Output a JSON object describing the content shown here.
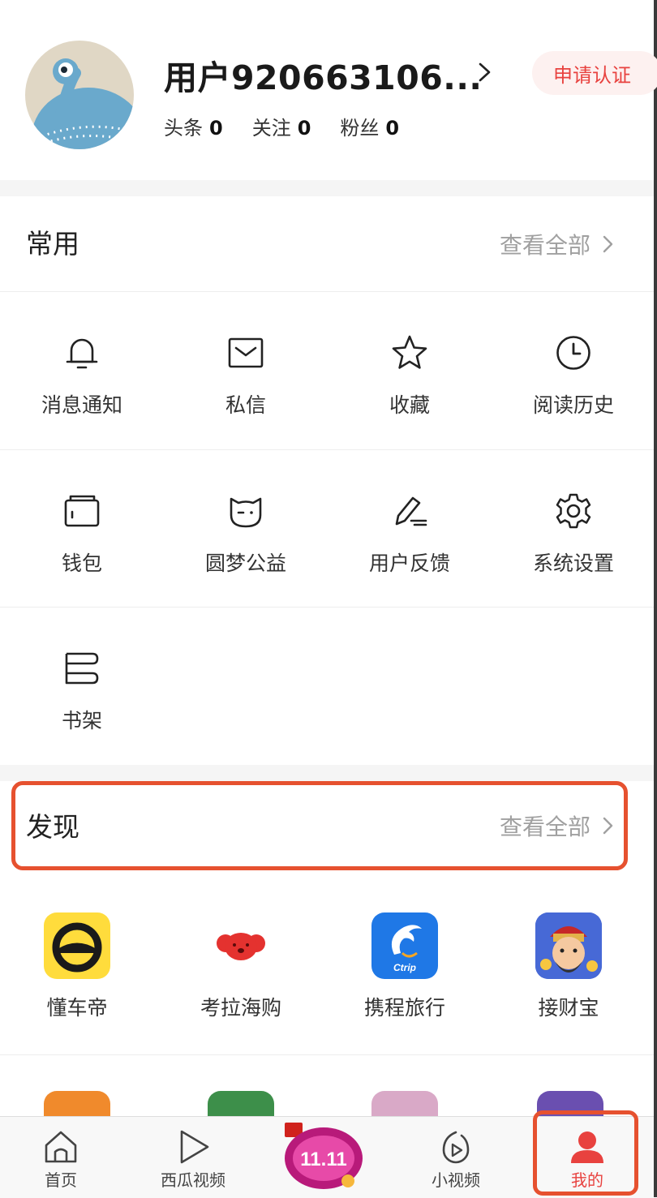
{
  "profile": {
    "username": "用户920663106...",
    "verify_label": "申请认证",
    "stats": [
      {
        "label": "头条",
        "value": "0"
      },
      {
        "label": "关注",
        "value": "0"
      },
      {
        "label": "粉丝",
        "value": "0"
      }
    ]
  },
  "common": {
    "title": "常用",
    "more": "查看全部",
    "items": [
      {
        "label": "消息通知",
        "icon": "bell-icon"
      },
      {
        "label": "私信",
        "icon": "mail-icon"
      },
      {
        "label": "收藏",
        "icon": "star-icon"
      },
      {
        "label": "阅读历史",
        "icon": "clock-icon"
      },
      {
        "label": "钱包",
        "icon": "wallet-icon"
      },
      {
        "label": "圆梦公益",
        "icon": "cat-face-icon"
      },
      {
        "label": "用户反馈",
        "icon": "pen-icon"
      },
      {
        "label": "系统设置",
        "icon": "gear-icon"
      },
      {
        "label": "书架",
        "icon": "bookshelf-icon"
      }
    ]
  },
  "discover": {
    "title": "发现",
    "more": "查看全部",
    "apps": [
      {
        "label": "懂车帝",
        "icon": "dongchedi-app-icon"
      },
      {
        "label": "考拉海购",
        "icon": "kaola-app-icon"
      },
      {
        "label": "携程旅行",
        "icon": "ctrip-app-icon",
        "icon_text": "Ctrip"
      },
      {
        "label": "接财宝",
        "icon": "jiecaibao-app-icon"
      }
    ]
  },
  "tabbar": {
    "tabs": [
      {
        "label": "首页",
        "icon": "home-icon"
      },
      {
        "label": "西瓜视频",
        "icon": "play-icon"
      },
      {
        "label": "小视频",
        "icon": "short-video-icon"
      },
      {
        "label": "我的",
        "icon": "user-icon",
        "active": true
      }
    ],
    "promo_text": "11.11"
  },
  "colors": {
    "accent": "#e8423f",
    "highlight_box": "#e6512f",
    "muted": "#a0a0a0"
  }
}
